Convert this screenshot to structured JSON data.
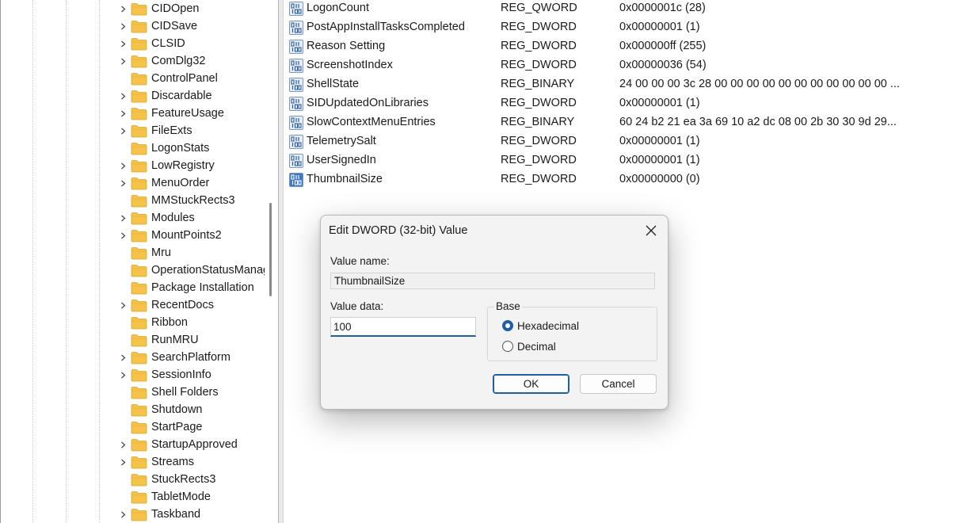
{
  "tree": {
    "items": [
      {
        "label": "CIDOpen",
        "expandable": true
      },
      {
        "label": "CIDSave",
        "expandable": true
      },
      {
        "label": "CLSID",
        "expandable": true
      },
      {
        "label": "ComDlg32",
        "expandable": true
      },
      {
        "label": "ControlPanel",
        "expandable": false
      },
      {
        "label": "Discardable",
        "expandable": true
      },
      {
        "label": "FeatureUsage",
        "expandable": true
      },
      {
        "label": "FileExts",
        "expandable": true
      },
      {
        "label": "LogonStats",
        "expandable": false
      },
      {
        "label": "LowRegistry",
        "expandable": true
      },
      {
        "label": "MenuOrder",
        "expandable": true
      },
      {
        "label": "MMStuckRects3",
        "expandable": false
      },
      {
        "label": "Modules",
        "expandable": true
      },
      {
        "label": "MountPoints2",
        "expandable": true
      },
      {
        "label": "Mru",
        "expandable": false
      },
      {
        "label": "OperationStatusManager",
        "expandable": false
      },
      {
        "label": "Package Installation",
        "expandable": false
      },
      {
        "label": "RecentDocs",
        "expandable": true
      },
      {
        "label": "Ribbon",
        "expandable": false
      },
      {
        "label": "RunMRU",
        "expandable": false
      },
      {
        "label": "SearchPlatform",
        "expandable": true
      },
      {
        "label": "SessionInfo",
        "expandable": true
      },
      {
        "label": "Shell Folders",
        "expandable": false
      },
      {
        "label": "Shutdown",
        "expandable": false
      },
      {
        "label": "StartPage",
        "expandable": false
      },
      {
        "label": "StartupApproved",
        "expandable": true
      },
      {
        "label": "Streams",
        "expandable": true
      },
      {
        "label": "StuckRects3",
        "expandable": false
      },
      {
        "label": "TabletMode",
        "expandable": false
      },
      {
        "label": "Taskband",
        "expandable": true
      }
    ]
  },
  "values": {
    "rows": [
      {
        "name": "LogonCount",
        "type": "REG_QWORD",
        "data": "0x0000001c (28)",
        "icon": "binary-value-icon"
      },
      {
        "name": "PostAppInstallTasksCompleted",
        "type": "REG_DWORD",
        "data": "0x00000001 (1)",
        "icon": "binary-value-icon"
      },
      {
        "name": "Reason Setting",
        "type": "REG_DWORD",
        "data": "0x000000ff (255)",
        "icon": "binary-value-icon"
      },
      {
        "name": "ScreenshotIndex",
        "type": "REG_DWORD",
        "data": "0x00000036 (54)",
        "icon": "binary-value-icon"
      },
      {
        "name": "ShellState",
        "type": "REG_BINARY",
        "data": "24 00 00 00 3c 28 00 00 00 00 00 00 00 00 00 00 00 ...",
        "icon": "binary-value-icon"
      },
      {
        "name": "SIDUpdatedOnLibraries",
        "type": "REG_DWORD",
        "data": "0x00000001 (1)",
        "icon": "binary-value-icon"
      },
      {
        "name": "SlowContextMenuEntries",
        "type": "REG_BINARY",
        "data": "60 24 b2 21 ea 3a 69 10 a2 dc 08 00 2b 30 30 9d 29...",
        "icon": "binary-value-icon"
      },
      {
        "name": "TelemetrySalt",
        "type": "REG_DWORD",
        "data": "0x00000001 (1)",
        "icon": "binary-value-icon"
      },
      {
        "name": "UserSignedIn",
        "type": "REG_DWORD",
        "data": "0x00000001 (1)",
        "icon": "binary-value-icon"
      },
      {
        "name": "ThumbnailSize",
        "type": "REG_DWORD",
        "data": "0x00000000 (0)",
        "icon": "binary-value-icon",
        "selected": true
      }
    ]
  },
  "dialog": {
    "title": "Edit DWORD (32-bit) Value",
    "value_name_label": "Value name:",
    "value_name": "ThumbnailSize",
    "value_data_label": "Value data:",
    "value_data": "100",
    "base_label": "Base",
    "base_options": [
      {
        "label": "Hexadecimal",
        "selected": true
      },
      {
        "label": "Decimal",
        "selected": false
      }
    ],
    "ok_label": "OK",
    "cancel_label": "Cancel"
  },
  "colors": {
    "folder": "#f5c24a",
    "accent": "#1e5fa8"
  }
}
